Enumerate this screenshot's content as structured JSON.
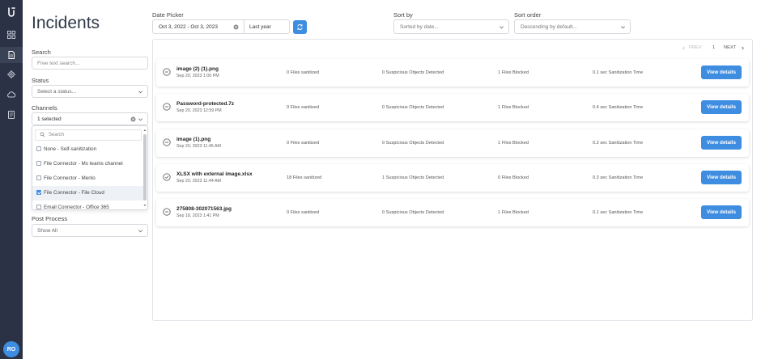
{
  "sidebar": {
    "logo_icon": "logo-icon",
    "icons": [
      "grid-icon",
      "document-icon",
      "settings-icon",
      "cloud-icon",
      "report-icon"
    ],
    "avatar_initials": "RO",
    "avatar_color": "#3f8de0"
  },
  "page": {
    "title": "Incidents"
  },
  "filters": {
    "search": {
      "label": "Search",
      "placeholder": "Free text search..."
    },
    "status": {
      "label": "Status",
      "placeholder": "Select a status..."
    },
    "channels": {
      "label": "Channels",
      "value": "1 selected",
      "dropdown_search_placeholder": "Search",
      "options": [
        {
          "label": "None - Self-sanitization",
          "checked": false
        },
        {
          "label": "File Connector - Ms teams channel",
          "checked": false
        },
        {
          "label": "File Connector - Menlo",
          "checked": false
        },
        {
          "label": "File Connector - File Cloud",
          "checked": true
        },
        {
          "label": "Email Connector - Office 365",
          "checked": false
        }
      ]
    },
    "post_process": {
      "label": "Post Process",
      "value": "Show All"
    }
  },
  "toolbar": {
    "date_picker": {
      "label": "Date Picker",
      "range": "Oct 3, 2022 - Oct 3, 2023",
      "preset": "Last year"
    },
    "sort_by": {
      "label": "Sort by",
      "placeholder": "Sorted by date..."
    },
    "sort_order": {
      "label": "Sort order",
      "placeholder": "Descending by default..."
    }
  },
  "pagination": {
    "prev": "PREV",
    "page": "1",
    "next": "NEXT"
  },
  "accent_color": "#3f8de0",
  "incidents": [
    {
      "name": "image (2) (1).png",
      "date": "Sep 20, 2023 1:00 PM",
      "sanitized": "0 Files sanitized",
      "suspicious": "0 Suspicious Objects Detected",
      "blocked": "1 Files Blocked",
      "time": "0.1 sec Sanitization Time",
      "action": "View details",
      "icon": "blocked-icon"
    },
    {
      "name": "Password-protected.7z",
      "date": "Sep 20, 2023 12:59 PM",
      "sanitized": "0 Files sanitized",
      "suspicious": "0 Suspicious Objects Detected",
      "blocked": "1 Files Blocked",
      "time": "0.4 sec Sanitization Time",
      "action": "View details",
      "icon": "blocked-icon"
    },
    {
      "name": "image (1).png",
      "date": "Sep 20, 2023 11:45 AM",
      "sanitized": "0 Files sanitized",
      "suspicious": "0 Suspicious Objects Detected",
      "blocked": "1 Files Blocked",
      "time": "0.2 sec Sanitization Time",
      "action": "View details",
      "icon": "blocked-icon"
    },
    {
      "name": "XLSX with external image.xlsx",
      "date": "Sep 20, 2023 11:44 AM",
      "sanitized": "18 Files sanitized",
      "suspicious": "1 Suspicious Objects Detected",
      "blocked": "0 Files Blocked",
      "time": "0.3 sec Sanitization Time",
      "action": "View details",
      "icon": "sanitized-icon"
    },
    {
      "name": "275808-302071563.jpg",
      "date": "Sep 18, 2023 1:41 PM",
      "sanitized": "0 Files sanitized",
      "suspicious": "0 Suspicious Objects Detected",
      "blocked": "1 Files Blocked",
      "time": "0.1 sec Sanitization Time",
      "action": "View details",
      "icon": "blocked-icon"
    }
  ]
}
